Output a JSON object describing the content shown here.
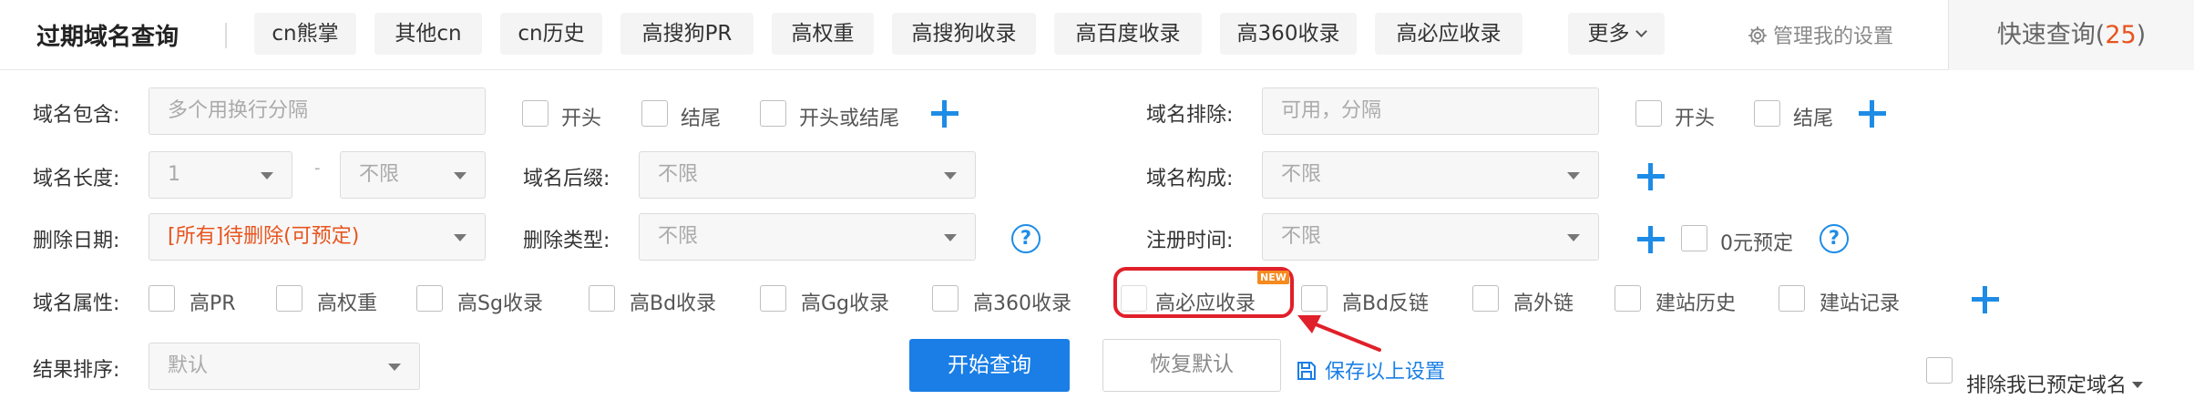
{
  "header": {
    "title": "过期域名查询",
    "tags": [
      "cn熊掌",
      "其他cn",
      "cn历史",
      "高搜狗PR",
      "高权重",
      "高搜狗收录",
      "高百度收录",
      "高360收录",
      "高必应收录"
    ],
    "more_label": "更多",
    "manage_label": "管理我的设置",
    "quick_label": "快速查询(",
    "quick_count": "25",
    "quick_close": ")"
  },
  "filters": {
    "domain_include": {
      "label": "域名包含:",
      "placeholder": "多个用换行分隔",
      "opts": [
        "开头",
        "结尾",
        "开头或结尾"
      ]
    },
    "domain_exclude": {
      "label": "域名排除:",
      "placeholder": "可用，分隔",
      "opts": [
        "开头",
        "结尾"
      ]
    },
    "length": {
      "label": "域名长度:",
      "min": "1",
      "dash": "-",
      "max": "不限"
    },
    "suffix": {
      "label": "域名后缀:",
      "value": "不限"
    },
    "composition": {
      "label": "域名构成:",
      "value": "不限"
    },
    "delete_date": {
      "label": "删除日期:",
      "value": "[所有]待删除(可预定)"
    },
    "delete_type": {
      "label": "删除类型:",
      "value": "不限"
    },
    "reg_time": {
      "label": "注册时间:",
      "value": "不限",
      "zero_label": "0元预定"
    },
    "attributes": {
      "label": "域名属性:",
      "items": [
        "高PR",
        "高权重",
        "高Sg收录",
        "高Bd收录",
        "高Gg收录",
        "高360收录",
        "高必应收录",
        "高Bd反链",
        "高外链",
        "建站历史",
        "建站记录"
      ],
      "new_badge": "NEW"
    },
    "sort": {
      "label": "结果排序:",
      "value": "默认"
    }
  },
  "actions": {
    "search": "开始查询",
    "reset": "恢复默认",
    "save": "保存以上设置",
    "exclude_reserved": "排除我已预定域名"
  },
  "colors": {
    "accent": "#1a7ee6",
    "highlight": "#e0202a",
    "orange": "#e8541e"
  }
}
